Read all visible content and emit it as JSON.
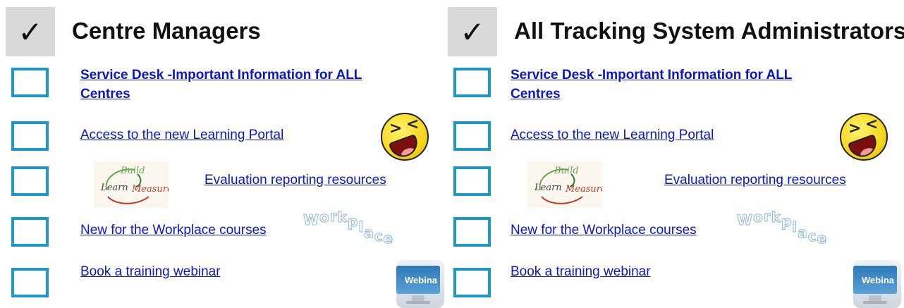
{
  "columns": [
    {
      "check_mark": "✓",
      "title": "Centre Managers",
      "links": {
        "service_desk": "Service Desk -Important Information for ALL Centres",
        "learning_portal": "Access to the new Learning Portal",
        "evaluation": "Evaluation reporting resources",
        "workplace_courses": "New for the Workplace courses",
        "webinar": "Book a training webinar"
      }
    },
    {
      "check_mark": "✓",
      "title": "All Tracking System Administrators",
      "links": {
        "service_desk": "Service Desk -Important Information for ALL Centres",
        "learning_portal": "Access to the new Learning Portal",
        "evaluation": "Evaluation reporting resources",
        "workplace_courses": "New for the Workplace courses",
        "webinar": "Book a training webinar"
      }
    }
  ],
  "images": {
    "cycle_words": [
      "Build",
      "Learn",
      "Measure"
    ],
    "workplace_word": "Workplace",
    "webinar_label": "Webina"
  },
  "colors": {
    "link": "#0b16c9",
    "checkbox_border": "#1f97c4",
    "header_box": "#d9d9d9"
  }
}
